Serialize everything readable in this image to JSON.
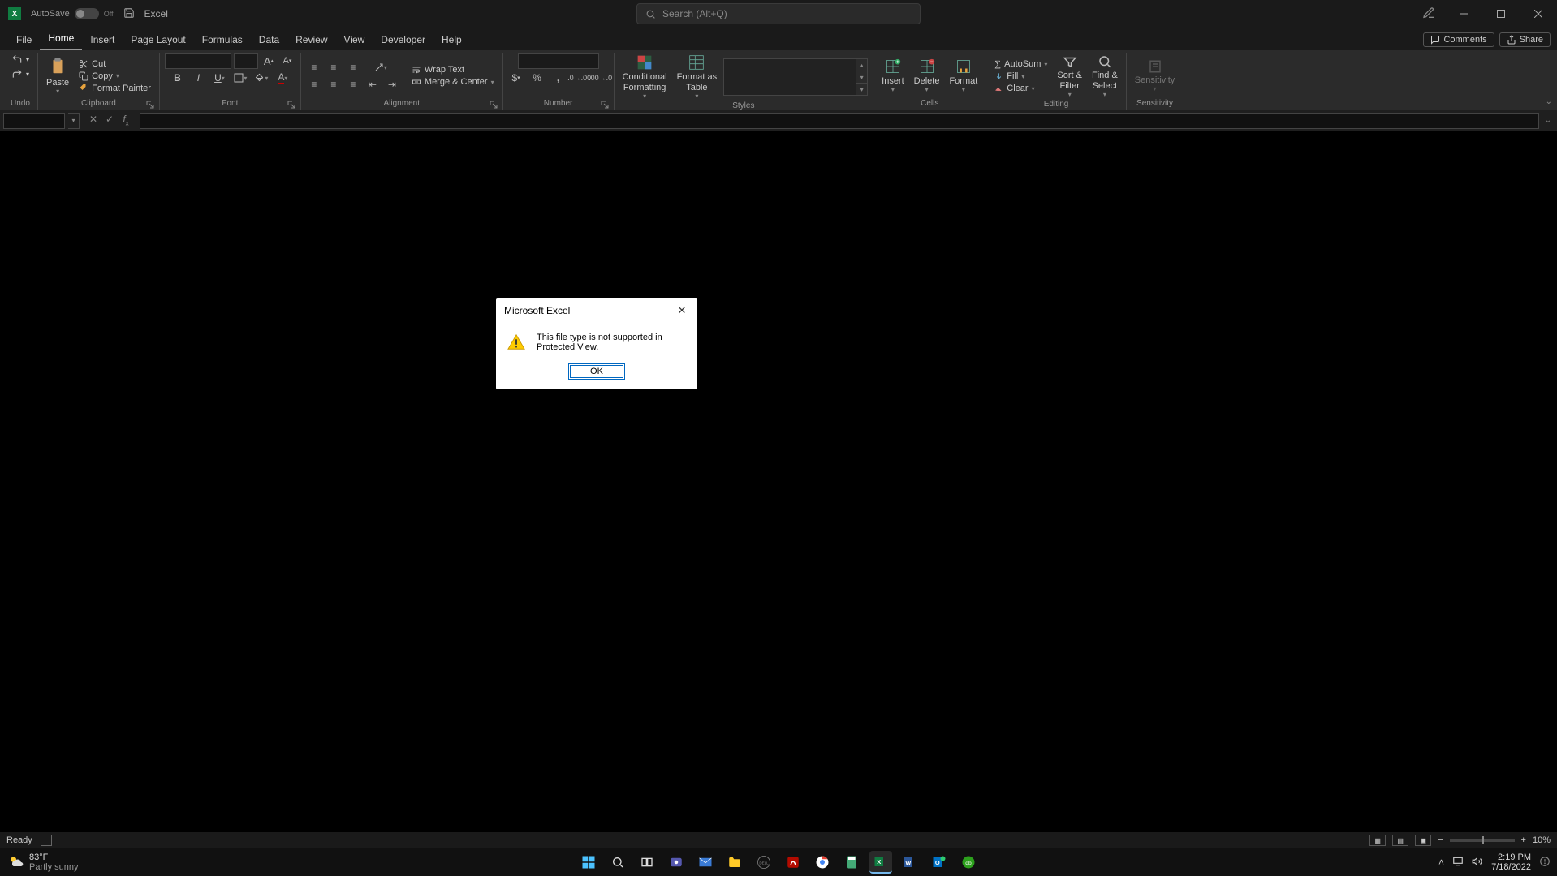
{
  "title": {
    "autosave_label": "AutoSave",
    "autosave_state": "Off",
    "app_name": "Excel",
    "search_placeholder": "Search (Alt+Q)"
  },
  "menubar": {
    "tabs": [
      "File",
      "Home",
      "Insert",
      "Page Layout",
      "Formulas",
      "Data",
      "Review",
      "View",
      "Developer",
      "Help"
    ],
    "active_index": 1,
    "comments": "Comments",
    "share": "Share"
  },
  "ribbon": {
    "undo": {
      "label": "Undo"
    },
    "clipboard": {
      "paste": "Paste",
      "cut": "Cut",
      "copy": "Copy",
      "format_painter": "Format Painter",
      "label": "Clipboard"
    },
    "font": {
      "label": "Font"
    },
    "alignment": {
      "wrap": "Wrap Text",
      "merge": "Merge & Center",
      "label": "Alignment"
    },
    "number": {
      "label": "Number"
    },
    "styles": {
      "cond": "Conditional\nFormatting",
      "fmt_table": "Format as\nTable",
      "label": "Styles"
    },
    "cells": {
      "insert": "Insert",
      "delete": "Delete",
      "format": "Format",
      "label": "Cells"
    },
    "editing": {
      "autosum": "AutoSum",
      "fill": "Fill",
      "clear": "Clear",
      "sort": "Sort &\nFilter",
      "find": "Find &\nSelect",
      "label": "Editing"
    },
    "sensitivity": {
      "btn": "Sensitivity",
      "label": "Sensitivity"
    }
  },
  "dialog": {
    "title": "Microsoft Excel",
    "message": "This file type is not supported in Protected View.",
    "ok": "OK"
  },
  "status": {
    "ready": "Ready",
    "zoom": "10%"
  },
  "taskbar": {
    "temp": "83°F",
    "weather": "Partly sunny",
    "time": "2:19 PM",
    "date": "7/18/2022"
  }
}
